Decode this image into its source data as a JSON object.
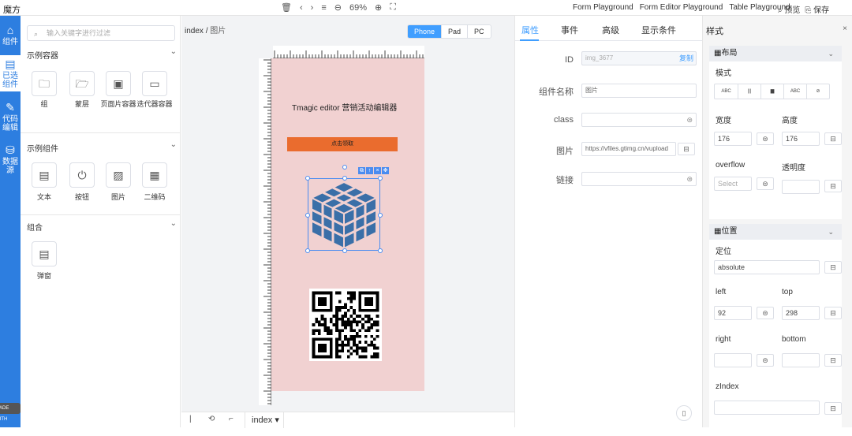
{
  "app": {
    "title": "魔方"
  },
  "toolbar": {
    "zoom": "69%",
    "links": [
      "Form Playground",
      "Form Editor Playground",
      "Table Playground"
    ],
    "preview": "预览",
    "save": "保存"
  },
  "rail": [
    {
      "label": "组件",
      "icon": "box-icon"
    },
    {
      "label": "已选组件",
      "icon": "layers-icon"
    },
    {
      "label": "代码编辑",
      "icon": "pen-icon"
    },
    {
      "label": "数据源",
      "icon": "database-icon"
    }
  ],
  "components": {
    "search_placeholder": "输入关键字进行过滤",
    "groups": [
      {
        "title": "示例容器",
        "items": [
          {
            "label": "组",
            "icon": "folder-icon"
          },
          {
            "label": "蒙层",
            "icon": "folder-open-icon"
          },
          {
            "label": "页面片容器",
            "icon": "film-icon"
          },
          {
            "label": "迭代器容器",
            "icon": "list-icon"
          }
        ]
      },
      {
        "title": "示例组件",
        "items": [
          {
            "label": "文本",
            "icon": "document-icon"
          },
          {
            "label": "按钮",
            "icon": "power-icon"
          },
          {
            "label": "图片",
            "icon": "image-icon"
          },
          {
            "label": "二维码",
            "icon": "grid-icon"
          }
        ]
      },
      {
        "title": "组合",
        "items": [
          {
            "label": "弹窗",
            "icon": "document-icon"
          }
        ]
      }
    ]
  },
  "workspace": {
    "breadcrumb_root": "index",
    "breadcrumb_sep": "/",
    "breadcrumb_current": "图片",
    "device_tabs": [
      "Phone",
      "Pad",
      "PC"
    ],
    "active_device": "Phone",
    "canvas_title": "Tmagic editor 营销活动编辑器",
    "canvas_button": "点击领取",
    "page_tab": "index",
    "colors": {
      "canvas_bg": "#f1d1d1",
      "button": "#ea6c2e",
      "cube": "#3a6fa8",
      "selection": "#4a8cf0"
    }
  },
  "properties": {
    "tabs": [
      "属性",
      "事件",
      "高级",
      "显示条件"
    ],
    "active_tab": "属性",
    "id_label": "ID",
    "id_value": "img_3677",
    "copy_label": "复制",
    "name_label": "组件名称",
    "name_value": "图片",
    "class_label": "class",
    "class_value": "",
    "src_label": "图片",
    "src_value": "https://vfiles.gtimg.cn/vupload",
    "link_label": "链接",
    "link_value": ""
  },
  "style": {
    "title": "样式",
    "layout_section": "布局",
    "mode_label": "模式",
    "mode_options": [
      "ABC",
      "|||",
      "▆",
      "ABC",
      "⊘"
    ],
    "width_label": "宽度",
    "width_value": "176",
    "height_label": "高度",
    "height_value": "176",
    "overflow_label": "overflow",
    "overflow_placeholder": "Select",
    "opacity_label": "透明度",
    "position_section": "位置",
    "pos_label": "定位",
    "pos_value": "absolute",
    "left_label": "left",
    "left_value": "92",
    "top_label": "top",
    "top_value": "298",
    "right_label": "right",
    "bottom_label": "bottom",
    "zindex_label": "zIndex"
  },
  "watermark": "MADE WITH GIFOX"
}
